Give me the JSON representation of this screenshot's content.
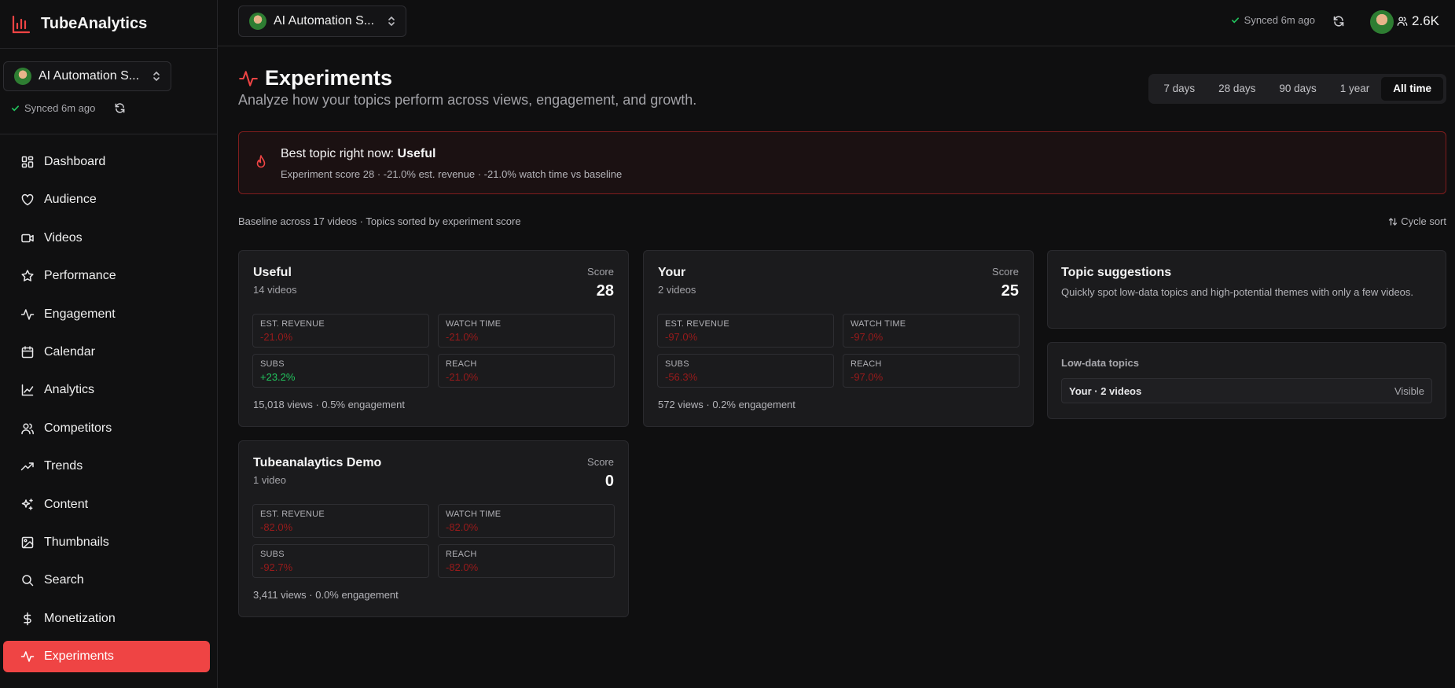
{
  "app": {
    "name": "TubeAnalytics"
  },
  "channel": {
    "name": "AI Automation S..."
  },
  "sync": {
    "status": "Synced 6m ago"
  },
  "header": {
    "subscribers": "2.6K"
  },
  "sidebar": {
    "items": [
      {
        "label": "Dashboard",
        "icon": "dashboard-icon"
      },
      {
        "label": "Audience",
        "icon": "heart-icon"
      },
      {
        "label": "Videos",
        "icon": "video-icon"
      },
      {
        "label": "Performance",
        "icon": "star-icon"
      },
      {
        "label": "Engagement",
        "icon": "activity-icon"
      },
      {
        "label": "Calendar",
        "icon": "calendar-icon"
      },
      {
        "label": "Analytics",
        "icon": "line-chart-icon"
      },
      {
        "label": "Competitors",
        "icon": "users-icon"
      },
      {
        "label": "Trends",
        "icon": "trending-up-icon"
      },
      {
        "label": "Content",
        "icon": "sparkles-icon"
      },
      {
        "label": "Thumbnails",
        "icon": "image-icon"
      },
      {
        "label": "Search",
        "icon": "search-icon"
      },
      {
        "label": "Monetization",
        "icon": "dollar-icon"
      },
      {
        "label": "Experiments",
        "icon": "activity-icon",
        "active": true
      }
    ]
  },
  "page": {
    "title": "Experiments",
    "subtitle": "Analyze how your topics perform across views, engagement, and growth."
  },
  "ranges": {
    "options": [
      "7 days",
      "28 days",
      "90 days",
      "1 year",
      "All time"
    ],
    "selected": "All time"
  },
  "best": {
    "prefix": "Best topic right now:",
    "topic": "Useful",
    "detail": "Experiment score 28 · -21.0% est. revenue · -21.0% watch time vs baseline"
  },
  "baseline": "Baseline across 17 videos · Topics sorted by experiment score",
  "cycle_sort": "Cycle sort",
  "score_label": "Score",
  "metric_labels": {
    "revenue": "EST. REVENUE",
    "watch": "WATCH TIME",
    "subs": "SUBS",
    "reach": "REACH"
  },
  "topics": [
    {
      "name": "Useful",
      "count": "14 videos",
      "score": "28",
      "revenue": "-21.0%",
      "watch": "-21.0%",
      "subs": "+23.2%",
      "reach": "-21.0%",
      "footer": "15,018 views · 0.5% engagement"
    },
    {
      "name": "Your",
      "count": "2 videos",
      "score": "25",
      "revenue": "-97.0%",
      "watch": "-97.0%",
      "subs": "-56.3%",
      "reach": "-97.0%",
      "footer": "572 views · 0.2% engagement"
    },
    {
      "name": "Tubeanalaytics Demo",
      "count": "1 video",
      "score": "0",
      "revenue": "-82.0%",
      "watch": "-82.0%",
      "subs": "-92.7%",
      "reach": "-82.0%",
      "footer": "3,411 views · 0.0% engagement"
    }
  ],
  "suggestions": {
    "title": "Topic suggestions",
    "description": "Quickly spot low-data topics and high-potential themes with only a few videos."
  },
  "low_data": {
    "title": "Low-data topics",
    "rows": [
      {
        "name": "Your · 2 videos",
        "status": "Visible"
      }
    ]
  },
  "colors": {
    "accent": "#ef4444",
    "negative": "#991b1b",
    "positive": "#22c55e",
    "background": "#0f0f10"
  }
}
